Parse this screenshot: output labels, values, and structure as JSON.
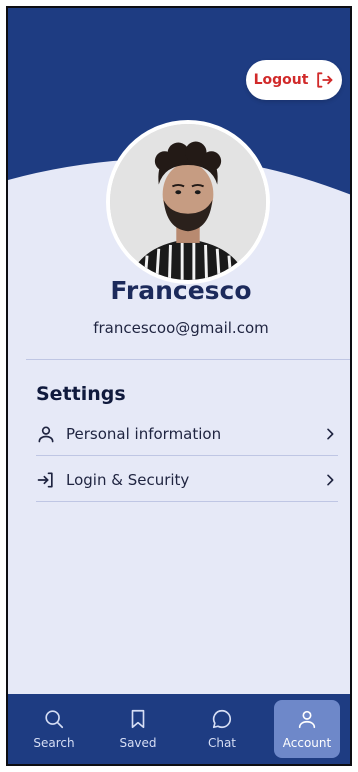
{
  "header": {
    "logout_label": "Logout",
    "colors": {
      "primary": "#1e3c82",
      "logout": "#d12a2a",
      "background": "#e6e9f7"
    }
  },
  "profile": {
    "name": "Francesco",
    "email": "francescoo@gmail.com",
    "avatar_icon": "profile-photo"
  },
  "settings": {
    "title": "Settings",
    "items": [
      {
        "label": "Personal information",
        "icon": "user-icon"
      },
      {
        "label": "Login & Security",
        "icon": "login-icon"
      }
    ]
  },
  "bottom_nav": {
    "items": [
      {
        "label": "Search",
        "icon": "search-icon",
        "active": false
      },
      {
        "label": "Saved",
        "icon": "bookmark-icon",
        "active": false
      },
      {
        "label": "Chat",
        "icon": "chat-icon",
        "active": false
      },
      {
        "label": "Account",
        "icon": "user-icon",
        "active": true
      }
    ]
  }
}
